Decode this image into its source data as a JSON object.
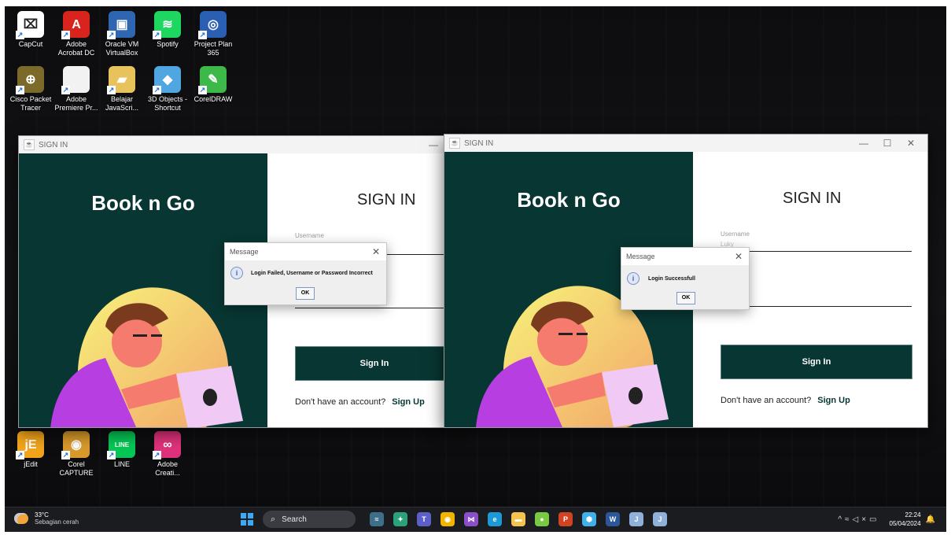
{
  "desktop": {
    "icons_row1": [
      {
        "label": "CapCut",
        "icon": "capcut-icon",
        "color": "#ffffff",
        "glyph": "⌧"
      },
      {
        "label": "Adobe Acrobat DC",
        "icon": "acrobat-icon",
        "color": "#d9231d",
        "glyph": "A"
      },
      {
        "label": "Oracle VM VirtualBox",
        "icon": "virtualbox-icon",
        "color": "#2f66b1",
        "glyph": "▣"
      },
      {
        "label": "Spotify",
        "icon": "spotify-icon",
        "color": "#1ed760",
        "glyph": "≋"
      },
      {
        "label": "Project Plan 365",
        "icon": "projectplan-icon",
        "color": "#2b5fb3",
        "glyph": "◎"
      }
    ],
    "icons_row2": [
      {
        "label": "Cisco Packet Tracer",
        "icon": "packet-tracer-icon",
        "color": "#7b6a2a",
        "glyph": "⊕"
      },
      {
        "label": "Adobe Premiere Pr...",
        "icon": "document-icon",
        "color": "#f2f2f2",
        "glyph": ""
      },
      {
        "label": "Belajar JavaScri...",
        "icon": "folder-icon",
        "color": "#e8c35c",
        "glyph": "▰"
      },
      {
        "label": "3D Objects - Shortcut",
        "icon": "3d-objects-icon",
        "color": "#4fa6e0",
        "glyph": "◆"
      },
      {
        "label": "CorelDRAW",
        "icon": "coreldraw-icon",
        "color": "#3db94a",
        "glyph": "✎"
      }
    ],
    "icons_row3": [
      {
        "label": "jEdit",
        "icon": "jedit-icon",
        "color": "#f2a51b",
        "glyph": "jE"
      },
      {
        "label": "Corel CAPTURE",
        "icon": "corel-capture-icon",
        "color": "#d89a2b",
        "glyph": "◉"
      },
      {
        "label": "LINE",
        "icon": "line-icon",
        "color": "#06c755",
        "glyph": "LINE"
      },
      {
        "label": "Adobe Creati...",
        "icon": "creative-cloud-icon",
        "color": "#e0327b",
        "glyph": "∞"
      }
    ]
  },
  "windows": [
    {
      "title": "SIGN IN",
      "brand": "Book n Go",
      "heading": "SIGN IN",
      "username_label": "Username",
      "username_value": "",
      "signin_button": "Sign In",
      "signup_prompt": "Don't have an account?",
      "signup_link": "Sign Up",
      "dialog": {
        "title": "Message",
        "message": "Login Failed, Username or Password Incorrect",
        "ok": "OK"
      }
    },
    {
      "title": "SIGN IN",
      "brand": "Book n Go",
      "heading": "SIGN IN",
      "username_label": "Username",
      "username_value": "Luky",
      "signin_button": "Sign In",
      "signup_prompt": "Don't have an account?",
      "signup_link": "Sign Up",
      "dialog": {
        "title": "Message",
        "message": "Login Successfull",
        "ok": "OK"
      }
    }
  ],
  "taskbar": {
    "weather_temp": "33°C",
    "weather_desc": "Sebagian cerah",
    "search_placeholder": "Search",
    "time": "22:24",
    "date": "05/04/2024",
    "apps": [
      {
        "name": "widgets-icon",
        "color": "#3d6f8a",
        "glyph": "≈"
      },
      {
        "name": "copilot-icon",
        "color": "#2aa37a",
        "glyph": "✦"
      },
      {
        "name": "teams-icon",
        "color": "#5b5fc7",
        "glyph": "T"
      },
      {
        "name": "chrome-icon",
        "color": "#f3b400",
        "glyph": "◉"
      },
      {
        "name": "visual-studio-icon",
        "color": "#8a4fc9",
        "glyph": "⋈"
      },
      {
        "name": "edge-icon",
        "color": "#1d9ad6",
        "glyph": "e"
      },
      {
        "name": "file-explorer-icon",
        "color": "#f4c34e",
        "glyph": "▬"
      },
      {
        "name": "color-app-icon",
        "color": "#7ac943",
        "glyph": "●"
      },
      {
        "name": "powerpoint-icon",
        "color": "#d04423",
        "glyph": "P"
      },
      {
        "name": "app-cube-icon",
        "color": "#3fb0e8",
        "glyph": "⬢"
      },
      {
        "name": "word-icon",
        "color": "#2b579a",
        "glyph": "W"
      },
      {
        "name": "java-app-icon",
        "color": "#8fb0d8",
        "glyph": "J"
      },
      {
        "name": "java-app-icon-2",
        "color": "#8fb0d8",
        "glyph": "J"
      }
    ]
  }
}
